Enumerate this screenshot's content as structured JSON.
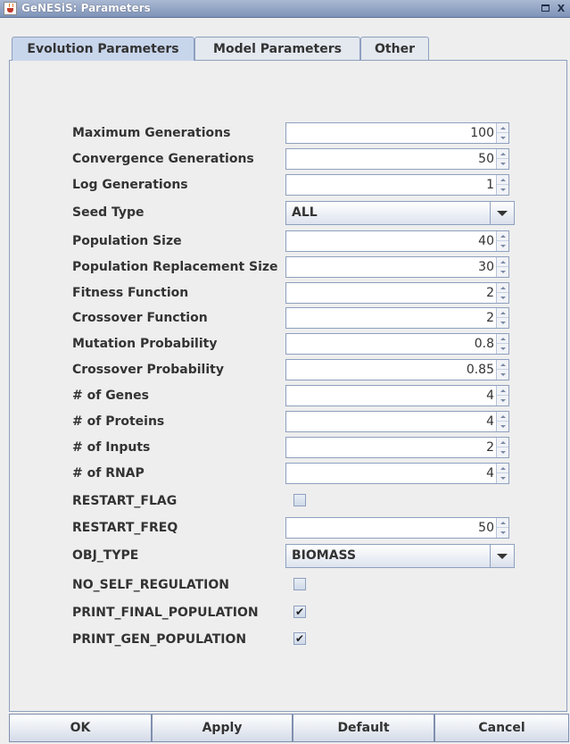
{
  "window": {
    "title": "GeNESiS: Parameters",
    "restore_glyph": "",
    "close_glyph": "X"
  },
  "tabs": [
    {
      "label": "Evolution Parameters",
      "active": true
    },
    {
      "label": "Model Parameters",
      "active": false
    },
    {
      "label": "Other",
      "active": false
    }
  ],
  "fields": {
    "maximum_generations": {
      "label": "Maximum Generations",
      "value": "100"
    },
    "convergence_generations": {
      "label": "Convergence Generations",
      "value": "50"
    },
    "log_generations": {
      "label": "Log Generations",
      "value": "1"
    },
    "seed_type": {
      "label": "Seed Type",
      "value": "ALL"
    },
    "population_size": {
      "label": "Population Size",
      "value": "40"
    },
    "population_replacement_size": {
      "label": "Population Replacement Size",
      "value": "30"
    },
    "fitness_function": {
      "label": "Fitness Function",
      "value": "2"
    },
    "crossover_function": {
      "label": "Crossover Function",
      "value": "2"
    },
    "mutation_probability": {
      "label": "Mutation Probability",
      "value": "0.8"
    },
    "crossover_probability": {
      "label": "Crossover Probability",
      "value": "0.85"
    },
    "num_genes": {
      "label": "# of Genes",
      "value": "4"
    },
    "num_proteins": {
      "label": "# of Proteins",
      "value": "4"
    },
    "num_inputs": {
      "label": "# of Inputs",
      "value": "2"
    },
    "num_rnap": {
      "label": "# of RNAP",
      "value": "4"
    },
    "restart_flag": {
      "label": "RESTART_FLAG",
      "checked": false,
      "mark": ""
    },
    "restart_freq": {
      "label": "RESTART_FREQ",
      "value": "50"
    },
    "obj_type": {
      "label": "OBJ_TYPE",
      "value": "BIOMASS"
    },
    "no_self_regulation": {
      "label": "NO_SELF_REGULATION",
      "checked": false,
      "mark": ""
    },
    "print_final_population": {
      "label": "PRINT_FINAL_POPULATION",
      "checked": true,
      "mark": "✔"
    },
    "print_gen_population": {
      "label": "PRINT_GEN_POPULATION",
      "checked": true,
      "mark": "✔"
    }
  },
  "buttons": {
    "ok": "OK",
    "apply": "Apply",
    "default": "Default",
    "cancel": "Cancel"
  },
  "colors": {
    "titlebar": "#7e93b8",
    "active_tab": "#c8d6ec",
    "border": "#8ea0be"
  }
}
